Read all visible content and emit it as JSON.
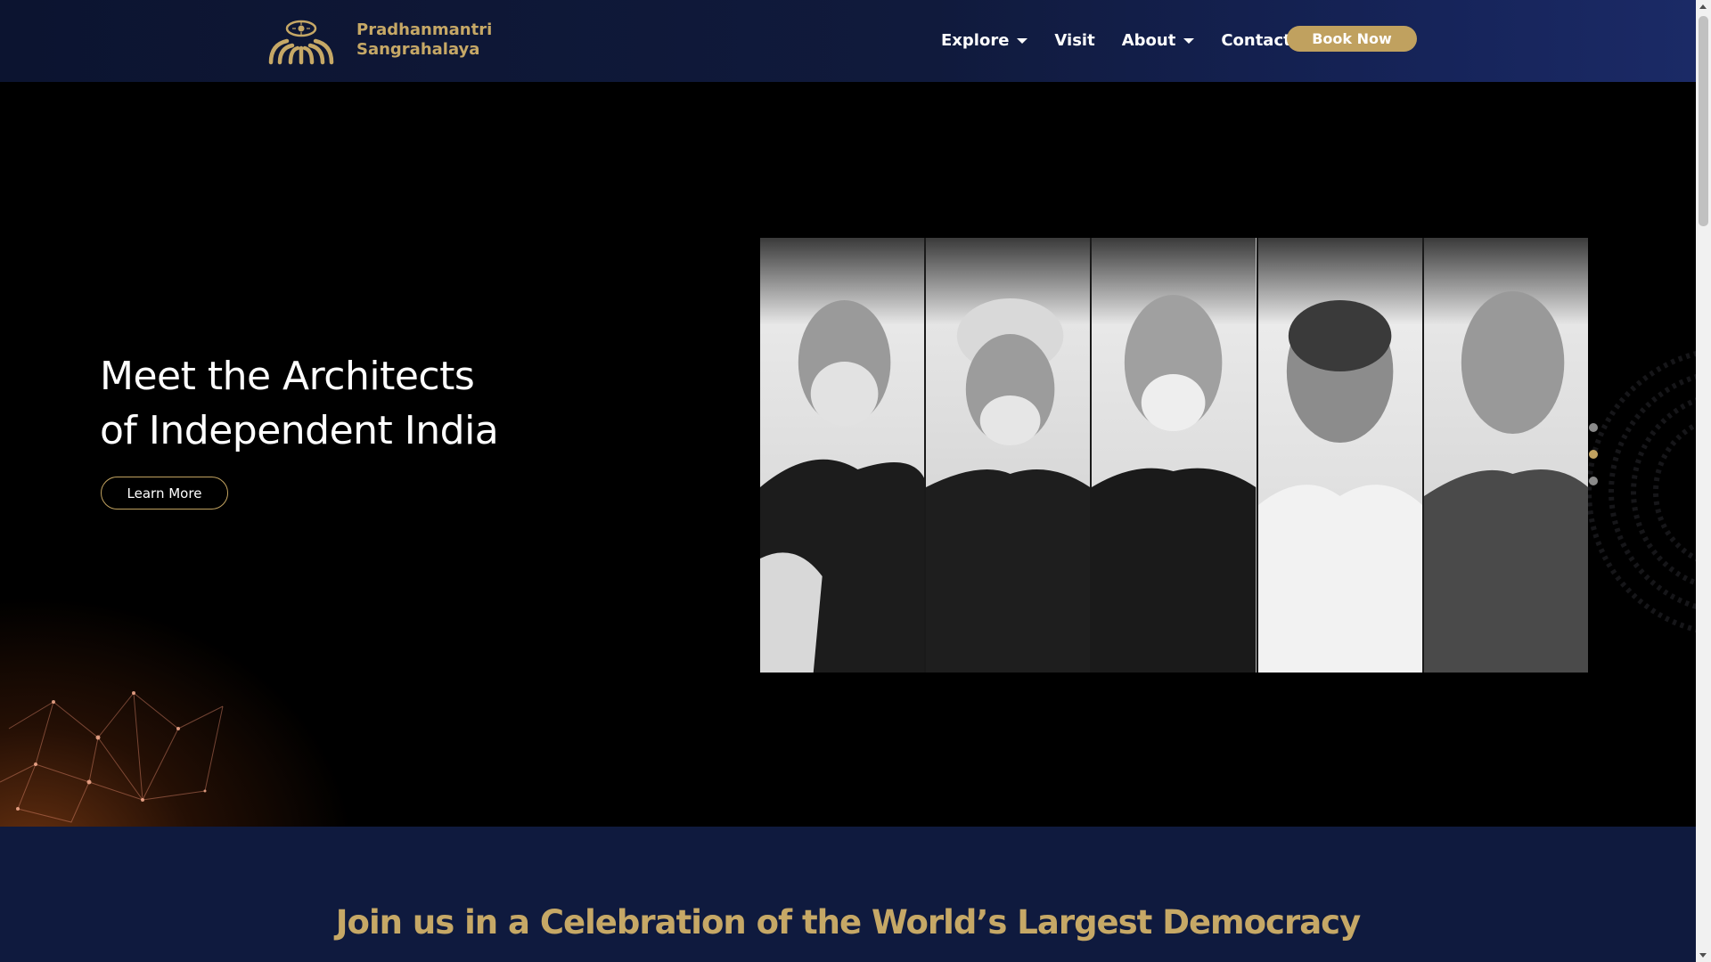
{
  "brand": {
    "line1": "Pradhanmantri",
    "line2": "Sangrahalaya",
    "logo_icon": "museum-logo-icon",
    "color": "#c6a866"
  },
  "nav": {
    "items": [
      {
        "label": "Explore",
        "has_dropdown": true
      },
      {
        "label": "Visit",
        "has_dropdown": false
      },
      {
        "label": "About",
        "has_dropdown": true
      },
      {
        "label": "Contact Us",
        "has_dropdown": true
      }
    ],
    "book_label": "Book Now"
  },
  "hero": {
    "title_line1": "Meet the Architects",
    "title_line2": "of Independent India",
    "cta_label": "Learn More",
    "portrait_count": 5,
    "slides": 3,
    "active_slide": 2
  },
  "section2": {
    "title": "Join us in a Celebration of the World’s Largest Democracy"
  },
  "colors": {
    "gold": "#c0a15f",
    "navy": "#0f1a3e",
    "black": "#000000"
  }
}
